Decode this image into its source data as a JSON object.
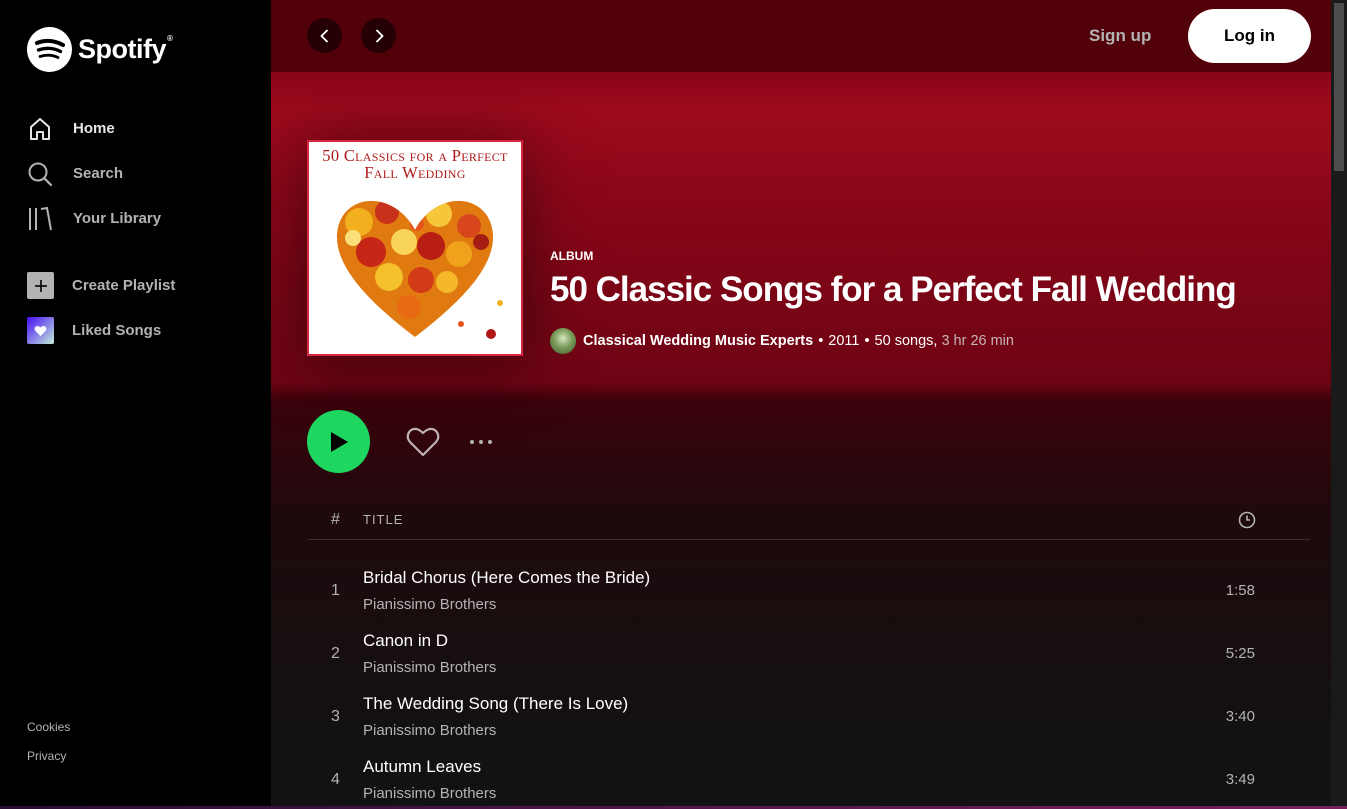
{
  "sidebar": {
    "logo_text": "Spotify",
    "logo_reg": "®",
    "nav": [
      {
        "label": "Home",
        "icon": "home-icon"
      },
      {
        "label": "Search",
        "icon": "search-icon"
      },
      {
        "label": "Your Library",
        "icon": "library-icon"
      }
    ],
    "create_playlist": "Create Playlist",
    "liked_songs": "Liked Songs",
    "legal": [
      "Cookies",
      "Privacy"
    ]
  },
  "topbar": {
    "signup": "Sign up",
    "login": "Log in"
  },
  "album": {
    "cover_text": "50 Classics for a Perfect Fall Wedding",
    "type": "ALBUM",
    "title": "50 Classic Songs for a Perfect Fall Wedding",
    "artist": "Classical Wedding Music Experts",
    "year": "2011",
    "songs": "50 songs,",
    "duration": "3 hr 26 min",
    "separator": "•"
  },
  "table": {
    "num_header": "#",
    "title_header": "TITLE"
  },
  "tracks": [
    {
      "num": "1",
      "title": "Bridal Chorus (Here Comes the Bride)",
      "artist": "Pianissimo Brothers",
      "duration": "1:58"
    },
    {
      "num": "2",
      "title": "Canon in D",
      "artist": "Pianissimo Brothers",
      "duration": "5:25"
    },
    {
      "num": "3",
      "title": "The Wedding Song (There Is Love)",
      "artist": "Pianissimo Brothers",
      "duration": "3:40"
    },
    {
      "num": "4",
      "title": "Autumn Leaves",
      "artist": "Pianissimo Brothers",
      "duration": "3:49"
    }
  ],
  "colors": {
    "accent": "#1ed760",
    "header_red": "#9c0a1c",
    "topbar": "#520009"
  }
}
